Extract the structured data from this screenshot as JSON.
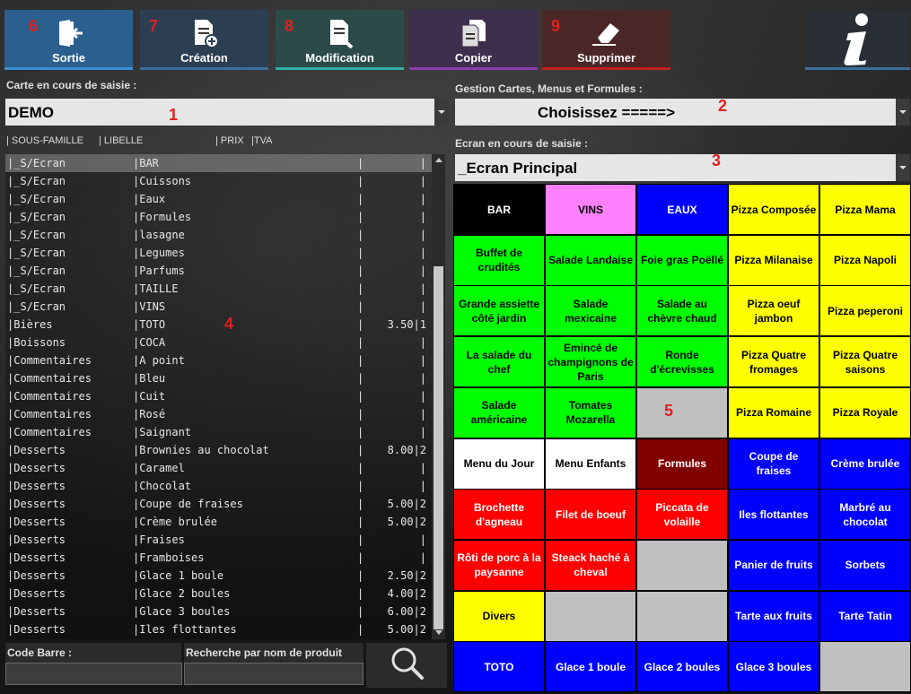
{
  "toolbar": [
    {
      "num": "6",
      "label": "Sortie",
      "icon": "exit-icon",
      "bg": "#2a5f8e",
      "accent": "#3a8fd0"
    },
    {
      "num": "7",
      "label": "Création",
      "icon": "new-document-icon",
      "bg": "#2c3e52",
      "accent": "#3a6ea0"
    },
    {
      "num": "8",
      "label": "Modification",
      "icon": "edit-document-icon",
      "bg": "#2c4a48",
      "accent": "#2fb0a8"
    },
    {
      "num": "",
      "label": "Copier",
      "icon": "copy-icon",
      "bg": "#3e2f4e",
      "accent": "#8a3db0"
    },
    {
      "num": "9",
      "label": "Supprimer",
      "icon": "eraser-icon",
      "bg": "#4a2626",
      "accent": "#c02020"
    }
  ],
  "info_icon": "info-icon",
  "carte": {
    "label": "Carte en cours de saisie :",
    "value": "DEMO",
    "num": "1"
  },
  "gestion": {
    "label": "Gestion Cartes, Menus et Formules  :",
    "value": "Choisissez  =====>",
    "num": "2"
  },
  "ecran": {
    "label": "Ecran en cours de saisie :",
    "value": "_Ecran Principal",
    "num": "3"
  },
  "list_headers": [
    "| SOUS-FAMILLE",
    "| LIBELLE",
    "| PRIX",
    "|TVA"
  ],
  "list_num": "4",
  "grid_num": "5",
  "rows": [
    [
      "|_S/Ecran",
      "|BAR",
      "|",
      "|"
    ],
    [
      "|_S/Ecran",
      "|Cuissons",
      "|",
      "|"
    ],
    [
      "|_S/Ecran",
      "|Eaux",
      "|",
      "|"
    ],
    [
      "|_S/Ecran",
      "|Formules",
      "|",
      "|"
    ],
    [
      "|_S/Ecran",
      "|lasagne",
      "|",
      "|"
    ],
    [
      "|_S/Ecran",
      "|Legumes",
      "|",
      "|"
    ],
    [
      "|_S/Ecran",
      "|Parfums",
      "|",
      "|"
    ],
    [
      "|_S/Ecran",
      "|TAILLE",
      "|",
      "|"
    ],
    [
      "|_S/Ecran",
      "|VINS",
      "|",
      "|"
    ],
    [
      "|Bières",
      "|TOTO",
      "|",
      "3.50|1"
    ],
    [
      "|Boissons",
      "|COCA",
      "|",
      "|"
    ],
    [
      "|Commentaires",
      "|A point",
      "|",
      "|"
    ],
    [
      "|Commentaires",
      "|Bleu",
      "|",
      "|"
    ],
    [
      "|Commentaires",
      "|Cuit",
      "|",
      "|"
    ],
    [
      "|Commentaires",
      "|Rosé",
      "|",
      "|"
    ],
    [
      "|Commentaires",
      "|Saignant",
      "|",
      "|"
    ],
    [
      "|Desserts",
      "|Brownies au chocolat",
      "|",
      "8.00|2"
    ],
    [
      "|Desserts",
      "|Caramel",
      "|",
      "|"
    ],
    [
      "|Desserts",
      "|Chocolat",
      "|",
      "|"
    ],
    [
      "|Desserts",
      "|Coupe de fraises",
      "|",
      "5.00|2"
    ],
    [
      "|Desserts",
      "|Crème brulée",
      "|",
      "5.00|2"
    ],
    [
      "|Desserts",
      "|Fraises",
      "|",
      "|"
    ],
    [
      "|Desserts",
      "|Framboises",
      "|",
      "|"
    ],
    [
      "|Desserts",
      "|Glace 1 boule",
      "|",
      "2.50|2"
    ],
    [
      "|Desserts",
      "|Glace 2 boules",
      "|",
      "4.00|2"
    ],
    [
      "|Desserts",
      "|Glace 3 boules",
      "|",
      "6.00|2"
    ],
    [
      "|Desserts",
      "|Iles flottantes",
      "|",
      "5.00|2"
    ]
  ],
  "search": {
    "code_label": "Code Barre :",
    "name_label": "Recherche par nom de produit",
    "icon": "search-icon"
  },
  "colors": {
    "black": "#000000",
    "pink": "#ff80ff",
    "blue": "#0000ff",
    "yellow": "#ffff00",
    "green": "#00ff00",
    "white": "#ffffff",
    "darkred": "#800000",
    "red": "#ff0000",
    "grey": "#c0c0c0"
  },
  "grid": [
    [
      [
        "BAR",
        "black"
      ],
      [
        "VINS",
        "pink"
      ],
      [
        "EAUX",
        "blue"
      ],
      [
        "Pizza Composée",
        "yellow"
      ],
      [
        "Pizza Mama",
        "yellow"
      ]
    ],
    [
      [
        "Buffet de crudités",
        "green"
      ],
      [
        "Salade Landaise",
        "green"
      ],
      [
        "Foie gras Poëllé",
        "green"
      ],
      [
        "Pizza Milanaise",
        "yellow"
      ],
      [
        "Pizza Napoli",
        "yellow"
      ]
    ],
    [
      [
        "Grande assiette côté jardin",
        "green"
      ],
      [
        "Salade mexicaine",
        "green"
      ],
      [
        "Salade au chèvre chaud",
        "green"
      ],
      [
        "Pizza oeuf jambon",
        "yellow"
      ],
      [
        "Pizza peperoni",
        "yellow"
      ]
    ],
    [
      [
        "La salade du chef",
        "green"
      ],
      [
        "Emincé de champignons de Paris",
        "green"
      ],
      [
        "Ronde d'écrevisses",
        "green"
      ],
      [
        "Pizza Quatre fromages",
        "yellow"
      ],
      [
        "Pizza Quatre saisons",
        "yellow"
      ]
    ],
    [
      [
        "Salade américaine",
        "green"
      ],
      [
        "Tomates Mozarella",
        "green"
      ],
      [
        "",
        "grey"
      ],
      [
        "Pizza Romaine",
        "yellow"
      ],
      [
        "Pizza Royale",
        "yellow"
      ]
    ],
    [
      [
        "Menu du Jour",
        "white"
      ],
      [
        "Menu Enfants",
        "white"
      ],
      [
        "Formules",
        "darkred"
      ],
      [
        "Coupe de fraises",
        "blue"
      ],
      [
        "Crème brulée",
        "blue"
      ]
    ],
    [
      [
        "Brochette d'agneau",
        "red"
      ],
      [
        "Filet de boeuf",
        "red"
      ],
      [
        "Piccata de volaille",
        "red"
      ],
      [
        "Iles flottantes",
        "blue"
      ],
      [
        "Marbré au chocolat",
        "blue"
      ]
    ],
    [
      [
        "Rôti de porc à la paysanne",
        "red"
      ],
      [
        "Steack haché à cheval",
        "red"
      ],
      [
        "",
        "grey"
      ],
      [
        "Panier de fruits",
        "blue"
      ],
      [
        "Sorbets",
        "blue"
      ]
    ],
    [
      [
        "Divers",
        "yellow"
      ],
      [
        "",
        "grey"
      ],
      [
        "",
        "grey"
      ],
      [
        "Tarte aux fruits",
        "blue"
      ],
      [
        "Tarte Tatin",
        "blue"
      ]
    ],
    [
      [
        "TOTO",
        "blue"
      ],
      [
        "Glace 1 boule",
        "blue"
      ],
      [
        "Glace 2 boules",
        "blue"
      ],
      [
        "Glace 3 boules",
        "blue"
      ],
      [
        "",
        "grey"
      ]
    ]
  ]
}
